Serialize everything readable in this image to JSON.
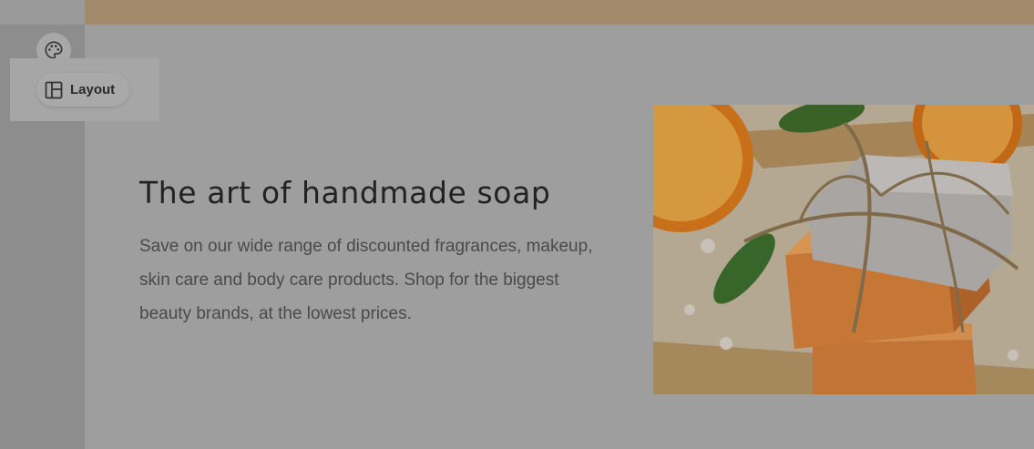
{
  "sidebar": {
    "buttons": [
      {
        "icon": "palette-icon"
      },
      {
        "icon": "layout-icon",
        "label": "Layout"
      }
    ]
  },
  "hero": {
    "title": "The art of handmade soap",
    "description": "Save on our wide range of discounted fragrances, makeup, skin care and body care products. Shop for the biggest beauty brands, at the lowest prices."
  },
  "colors": {
    "topbar": "#a28b6b",
    "overlay": "#9e9e9e",
    "soap": "#d8823a",
    "orange": "#e0791c"
  }
}
